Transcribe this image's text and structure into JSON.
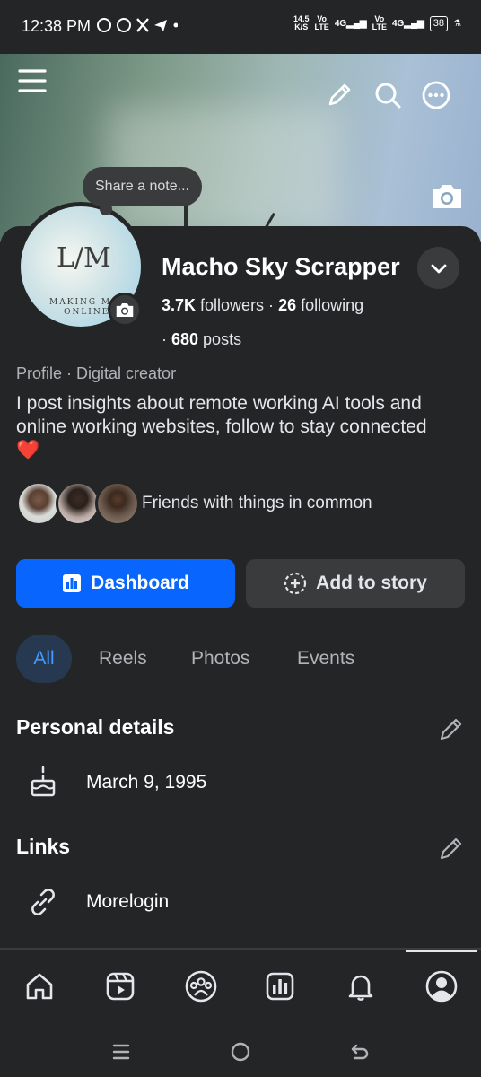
{
  "status_bar": {
    "time": "12:38 PM",
    "notifications": "◎◎𝕏➤•",
    "net_speed": "14.5\nK/S",
    "volte1": "Vo\nLTE",
    "sig1": "4G.ıll",
    "volte2": "Vo\nLTE",
    "sig2": "4G.ıll",
    "battery": "38"
  },
  "cover": {
    "hamburger_icon": "menu-icon",
    "edit_icon": "pencil-icon",
    "search_icon": "search-icon",
    "more_icon": "more-icon",
    "camera_icon": "camera-icon"
  },
  "profile": {
    "note_prompt": "Share a note...",
    "avatar_logo": "L/M",
    "avatar_logo_sub": "MAKING MO\n ONLINE",
    "name": "Macho Sky Scrapper",
    "followers_count": "3.7K",
    "followers_label": " followers · ",
    "following_count": "26",
    "following_label": " following",
    "posts_prefix": "· ",
    "posts_count": "680",
    "posts_label": " posts",
    "category": "Profile · Digital creator",
    "bio": "I post insights about remote working AI tools and online working websites, follow to stay connected",
    "bio_emoji": "❤️",
    "friends_text": "Friends with things in common"
  },
  "actions": {
    "dashboard_label": "Dashboard",
    "add_story_label": "Add to story"
  },
  "tabs": [
    {
      "label": "All",
      "active": true
    },
    {
      "label": "Reels"
    },
    {
      "label": "Photos"
    },
    {
      "label": "Events"
    }
  ],
  "personal_details": {
    "title": "Personal details",
    "birthday": "March 9, 1995"
  },
  "links": {
    "title": "Links",
    "link1": "Morelogin"
  },
  "colors": {
    "accent": "#0866ff",
    "background": "#242526",
    "surface": "#3a3b3c",
    "active_tab_bg": "#263951",
    "active_tab_text": "#4599ff"
  }
}
